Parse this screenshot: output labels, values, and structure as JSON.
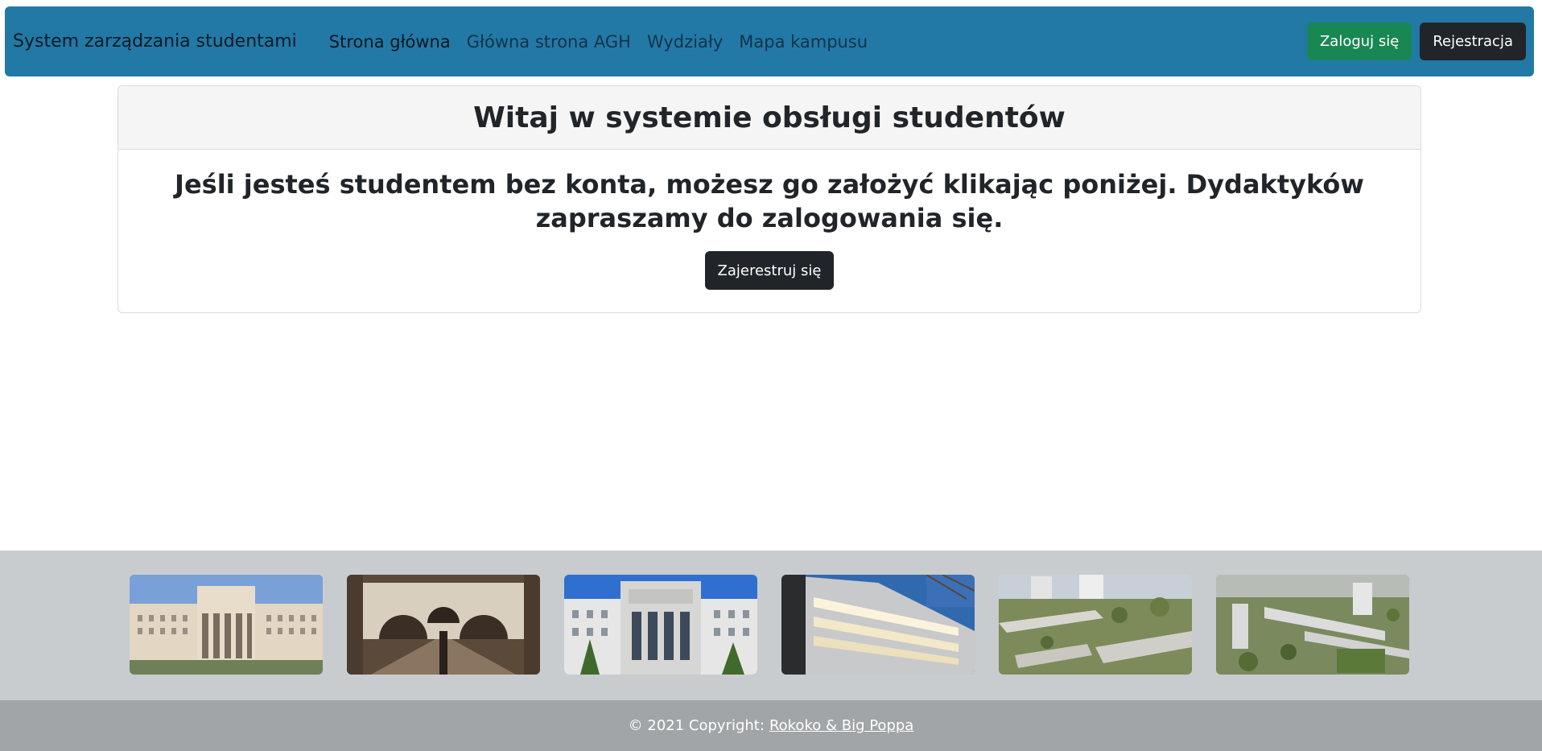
{
  "navbar": {
    "brand": "System zarządzania studentami",
    "links": [
      {
        "label": "Strona główna"
      },
      {
        "label": "Główna strona AGH"
      },
      {
        "label": "Wydziały"
      },
      {
        "label": "Mapa kampusu"
      }
    ],
    "login_label": "Zaloguj się",
    "register_label": "Rejestracja"
  },
  "card": {
    "title": "Witaj w systemie obsługi studentów",
    "text": "Jeśli jesteś studentem bez konta, możesz go założyć klikając poniżej. Dydaktyków zapraszamy do zalogowania się.",
    "button_label": "Zajerestruj się"
  },
  "footer": {
    "copyright": "© 2021 Copyright:",
    "link_text": "Rokoko & Big Poppa"
  },
  "colors": {
    "navbar_bg": "#2279a6",
    "success": "#198754",
    "dark": "#212529",
    "gallery_bg": "#c8cccf",
    "footer_bg": "#a1a5a8"
  }
}
